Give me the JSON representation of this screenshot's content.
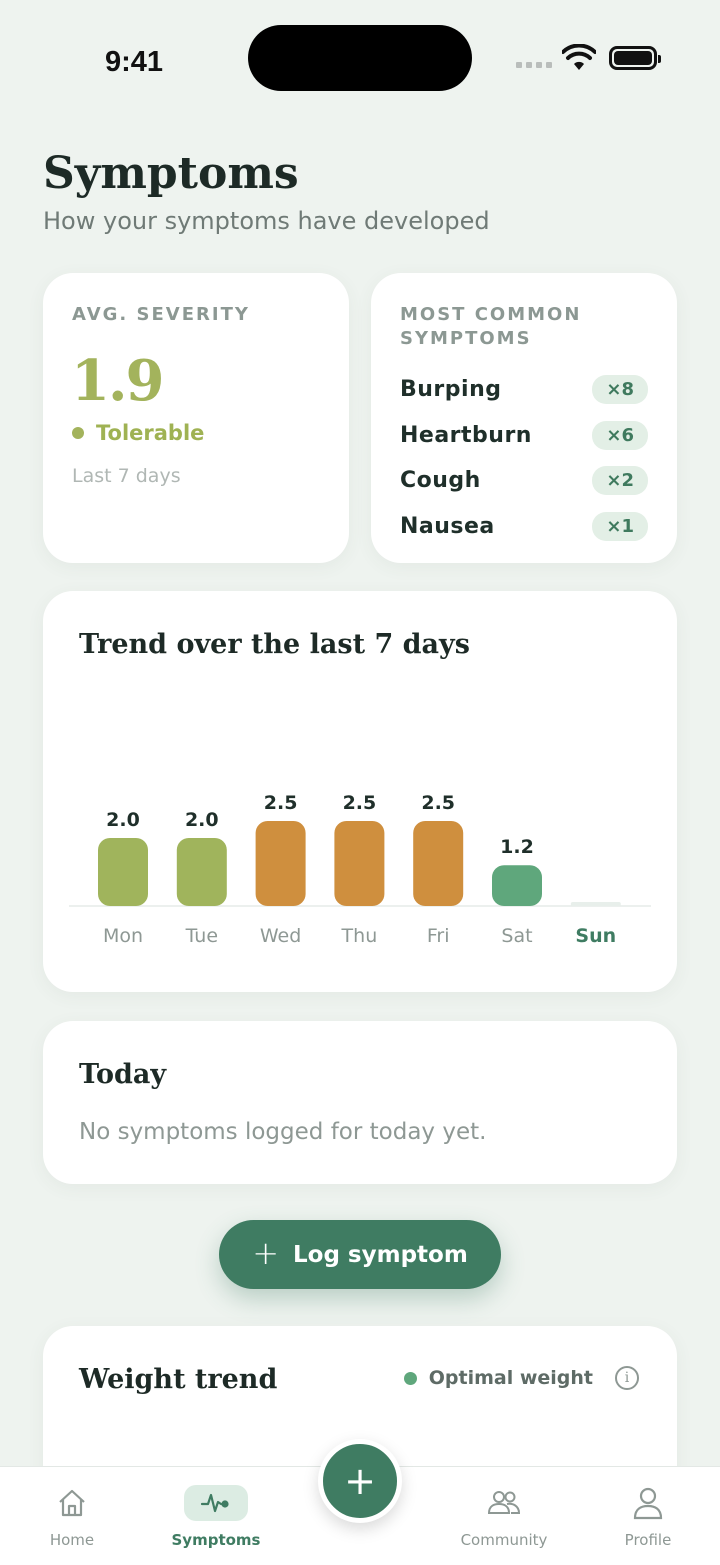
{
  "status": {
    "time": "9:41"
  },
  "header": {
    "title": "Symptoms",
    "subtitle": "How your symptoms have developed"
  },
  "severity": {
    "label": "AVG. SEVERITY",
    "value": "1.9",
    "status": "Tolerable",
    "period": "Last 7 days",
    "color": "#a3b35c"
  },
  "common": {
    "label": "MOST COMMON SYMPTOMS",
    "items": [
      {
        "name": "Burping",
        "count": "×8"
      },
      {
        "name": "Heartburn",
        "count": "×6"
      },
      {
        "name": "Cough",
        "count": "×2"
      },
      {
        "name": "Nausea",
        "count": "×1"
      }
    ]
  },
  "trend": {
    "title": "Trend over the last 7 days"
  },
  "chart_data": {
    "type": "bar",
    "categories": [
      "Mon",
      "Tue",
      "Wed",
      "Thu",
      "Fri",
      "Sat",
      "Sun"
    ],
    "values": [
      2.0,
      2.0,
      2.5,
      2.5,
      2.5,
      1.2,
      null
    ],
    "value_labels": [
      "2.0",
      "2.0",
      "2.5",
      "2.5",
      "2.5",
      "1.2",
      ""
    ],
    "colors": [
      "#a0b45c",
      "#a0b45c",
      "#cf8f3e",
      "#cf8f3e",
      "#cf8f3e",
      "#5fa77c",
      "#e8efeb"
    ],
    "highlight_category": "Sun",
    "ylim": [
      0,
      3
    ],
    "title": "Trend over the last 7 days"
  },
  "today": {
    "title": "Today",
    "empty": "No symptoms logged for today yet."
  },
  "log_button": {
    "icon": "plus-icon",
    "label": "Log symptom"
  },
  "weight": {
    "title": "Weight trend",
    "legend": "Optimal weight",
    "legend_color": "#5fa77c",
    "info_glyph": "i"
  },
  "tabs": [
    {
      "label": "Home",
      "icon": "home-icon"
    },
    {
      "label": "Symptoms",
      "icon": "pulse-icon",
      "active": true
    },
    {
      "label": "Community",
      "icon": "people-icon"
    },
    {
      "label": "Profile",
      "icon": "person-icon"
    }
  ],
  "fab": {
    "icon": "plus-icon",
    "glyph": "+"
  }
}
